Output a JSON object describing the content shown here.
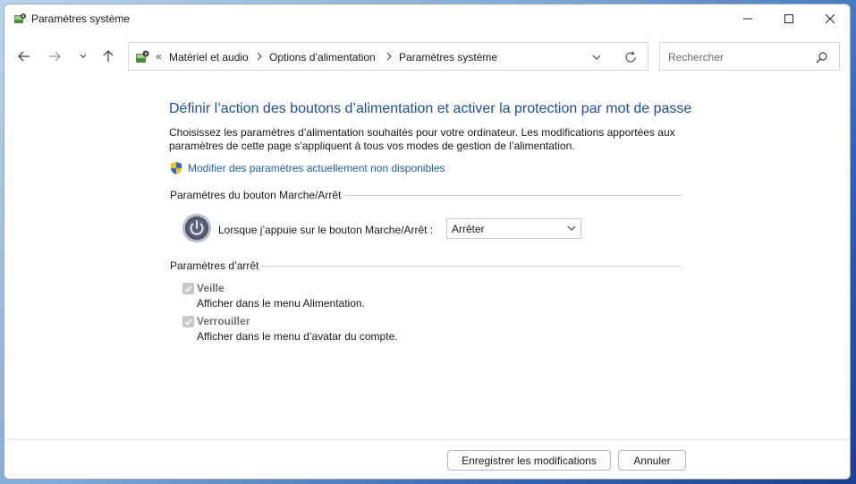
{
  "window": {
    "title": "Paramètres système",
    "controls": {
      "minimize": "minimize",
      "maximize": "maximize",
      "close": "close"
    }
  },
  "navigation": {
    "back_icon": "arrow-left-icon",
    "forward_icon": "arrow-right-icon",
    "recent_icon": "chevron-down-icon",
    "up_icon": "arrow-up-icon"
  },
  "address": {
    "overflow": "«",
    "breadcrumbs": [
      "Matériel et audio",
      "Options d’alimentation",
      "Paramètres système"
    ]
  },
  "search": {
    "placeholder": "Rechercher"
  },
  "page": {
    "heading": "Définir l’action des boutons d’alimentation et activer la protection par mot de passe",
    "description": "Choisissez les paramètres d’alimentation souhaités pour votre ordinateur. Les modifications apportées aux paramètres de cette page s’appliquent à tous vos modes de gestion de l’alimentation.",
    "unlock_link": "Modifier des paramètres actuellement non disponibles",
    "power_button_group": {
      "title": "Paramètres du bouton Marche/Arrêt",
      "label": "Lorsque j’appuie sur le bouton Marche/Arrêt :",
      "selected": "Arrêter"
    },
    "shutdown_group": {
      "title": "Paramètres d’arrêt",
      "items": [
        {
          "title": "Veille",
          "description": "Afficher dans le menu Alimentation.",
          "checked": true,
          "disabled": true
        },
        {
          "title": "Verrouiller",
          "description": "Afficher dans le menu d’avatar du compte.",
          "checked": true,
          "disabled": true
        }
      ]
    }
  },
  "footer": {
    "save_label": "Enregistrer les modifications",
    "cancel_label": "Annuler"
  },
  "colors": {
    "heading": "#1e4e9c",
    "link": "#1e5fb4",
    "disabled_text": "#6d6d6d"
  }
}
